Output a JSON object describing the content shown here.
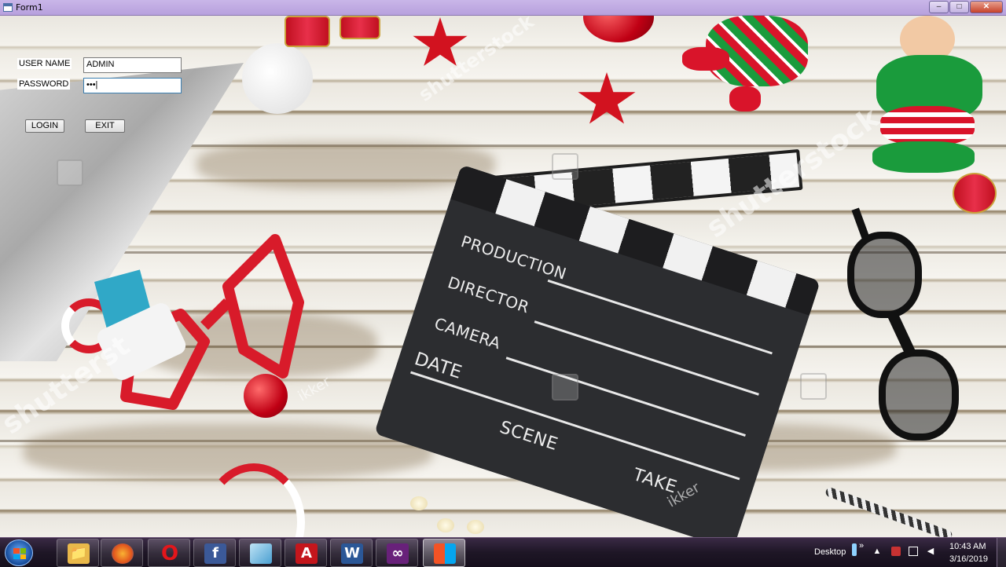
{
  "window": {
    "title": "Form1",
    "minimize_glyph": "–",
    "maximize_glyph": "□",
    "close_glyph": "✕"
  },
  "form": {
    "username_label": "USER NAME",
    "username_value": "ADMIN",
    "password_label": "PASSWORD",
    "password_value": "•••|",
    "login_label": "LOGIN",
    "exit_label": "EXIT"
  },
  "background": {
    "clapper_production": "PRODUCTION",
    "clapper_director": "DIRECTOR",
    "clapper_camera": "CAMERA",
    "clapper_date": "DATE",
    "clapper_scene": "SCENE",
    "clapper_take": "TAKE",
    "watermark_1": "shutterstock",
    "watermark_2": "shutterstock",
    "watermark_3": "shutterst",
    "watermark_small_1": "ikker",
    "watermark_small_2": "ikker"
  },
  "taskbar": {
    "pinned": [
      {
        "name": "windows-explorer",
        "glyph": "📁"
      },
      {
        "name": "firefox",
        "glyph": "●"
      },
      {
        "name": "opera",
        "glyph": "O"
      },
      {
        "name": "facebook",
        "glyph": "f"
      },
      {
        "name": "app-blue",
        "glyph": "▰"
      },
      {
        "name": "adobe-reader",
        "glyph": "A"
      },
      {
        "name": "word",
        "glyph": "W"
      },
      {
        "name": "visual-studio",
        "glyph": "∞"
      },
      {
        "name": "active-app",
        "glyph": "▦"
      }
    ],
    "desktop_label": "Desktop",
    "desktop_chevron": "»",
    "time": "10:43 AM",
    "date": "3/16/2019"
  },
  "colors": {
    "titlebar": "#b7a0dd",
    "taskbar": "#1e1626",
    "clapper": "#2c2d30"
  }
}
